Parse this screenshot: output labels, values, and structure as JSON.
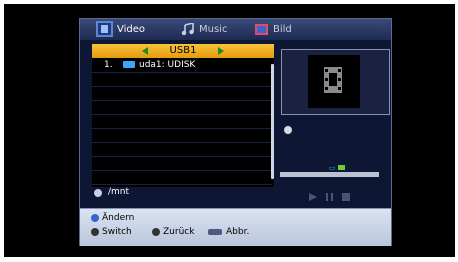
{
  "tabs": [
    {
      "label": "Video",
      "icon": "film-icon",
      "active": true
    },
    {
      "label": "Music",
      "icon": "music-note-icon",
      "active": false
    },
    {
      "label": "Bild",
      "icon": "picture-icon",
      "active": false
    }
  ],
  "device": {
    "label": "USB1"
  },
  "files": [
    {
      "number": "1.",
      "icon": "usb-drive-icon",
      "name": "uda1: UDISK"
    }
  ],
  "path": "/mnt",
  "help": {
    "change": "Ändern",
    "switch": "Switch",
    "back": "Zurück",
    "abort": "Abbr."
  },
  "colors": {
    "accent": "#f3b02a",
    "panel": "#0d1633",
    "selection_arrows": "#1b8e1b"
  }
}
